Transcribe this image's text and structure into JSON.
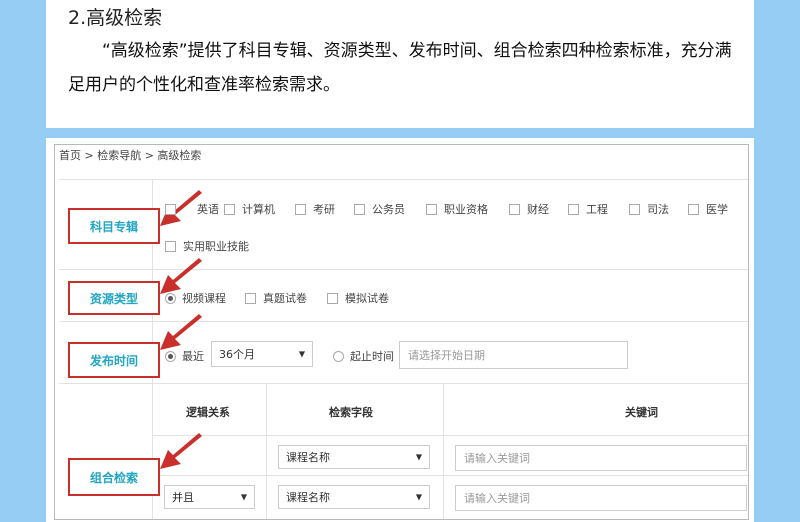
{
  "doc": {
    "section_title": "2.高级检索",
    "paragraph": "“高级检索”提供了科目专辑、资源类型、发布时间、组合检索四种检索标准，充分满足用户的个性化和查准率检索需求。"
  },
  "screenshot": {
    "breadcrumb": "首页 > 检索导航 > 高级检索",
    "labels": {
      "subject": "科目专辑",
      "resource_type": "资源类型",
      "publish_time": "发布时间",
      "combined": "组合检索"
    },
    "subjects": [
      "英语",
      "计算机",
      "考研",
      "公务员",
      "职业资格",
      "财经",
      "工程",
      "司法",
      "医学",
      "实用职业技能"
    ],
    "resource_types": [
      "视频课程",
      "真题试卷",
      "模拟试卷"
    ],
    "resource_type_selected": "视频课程",
    "time": {
      "recent_label": "最近",
      "recent_value": "36个月",
      "range_label": "起止时间",
      "date_placeholder": "请选择开始日期"
    },
    "combined_table": {
      "headers": [
        "逻辑关系",
        "检索字段",
        "关键词"
      ],
      "rows": [
        {
          "logic": "",
          "field": "课程名称",
          "keyword_placeholder": "请输入关键词"
        },
        {
          "logic": "并且",
          "field": "课程名称",
          "keyword_placeholder": "请输入关键词"
        }
      ]
    },
    "colors": {
      "highlight_border": "#c9302c",
      "label_text": "#21a5c3",
      "page_bg": "#96cdf5"
    }
  }
}
